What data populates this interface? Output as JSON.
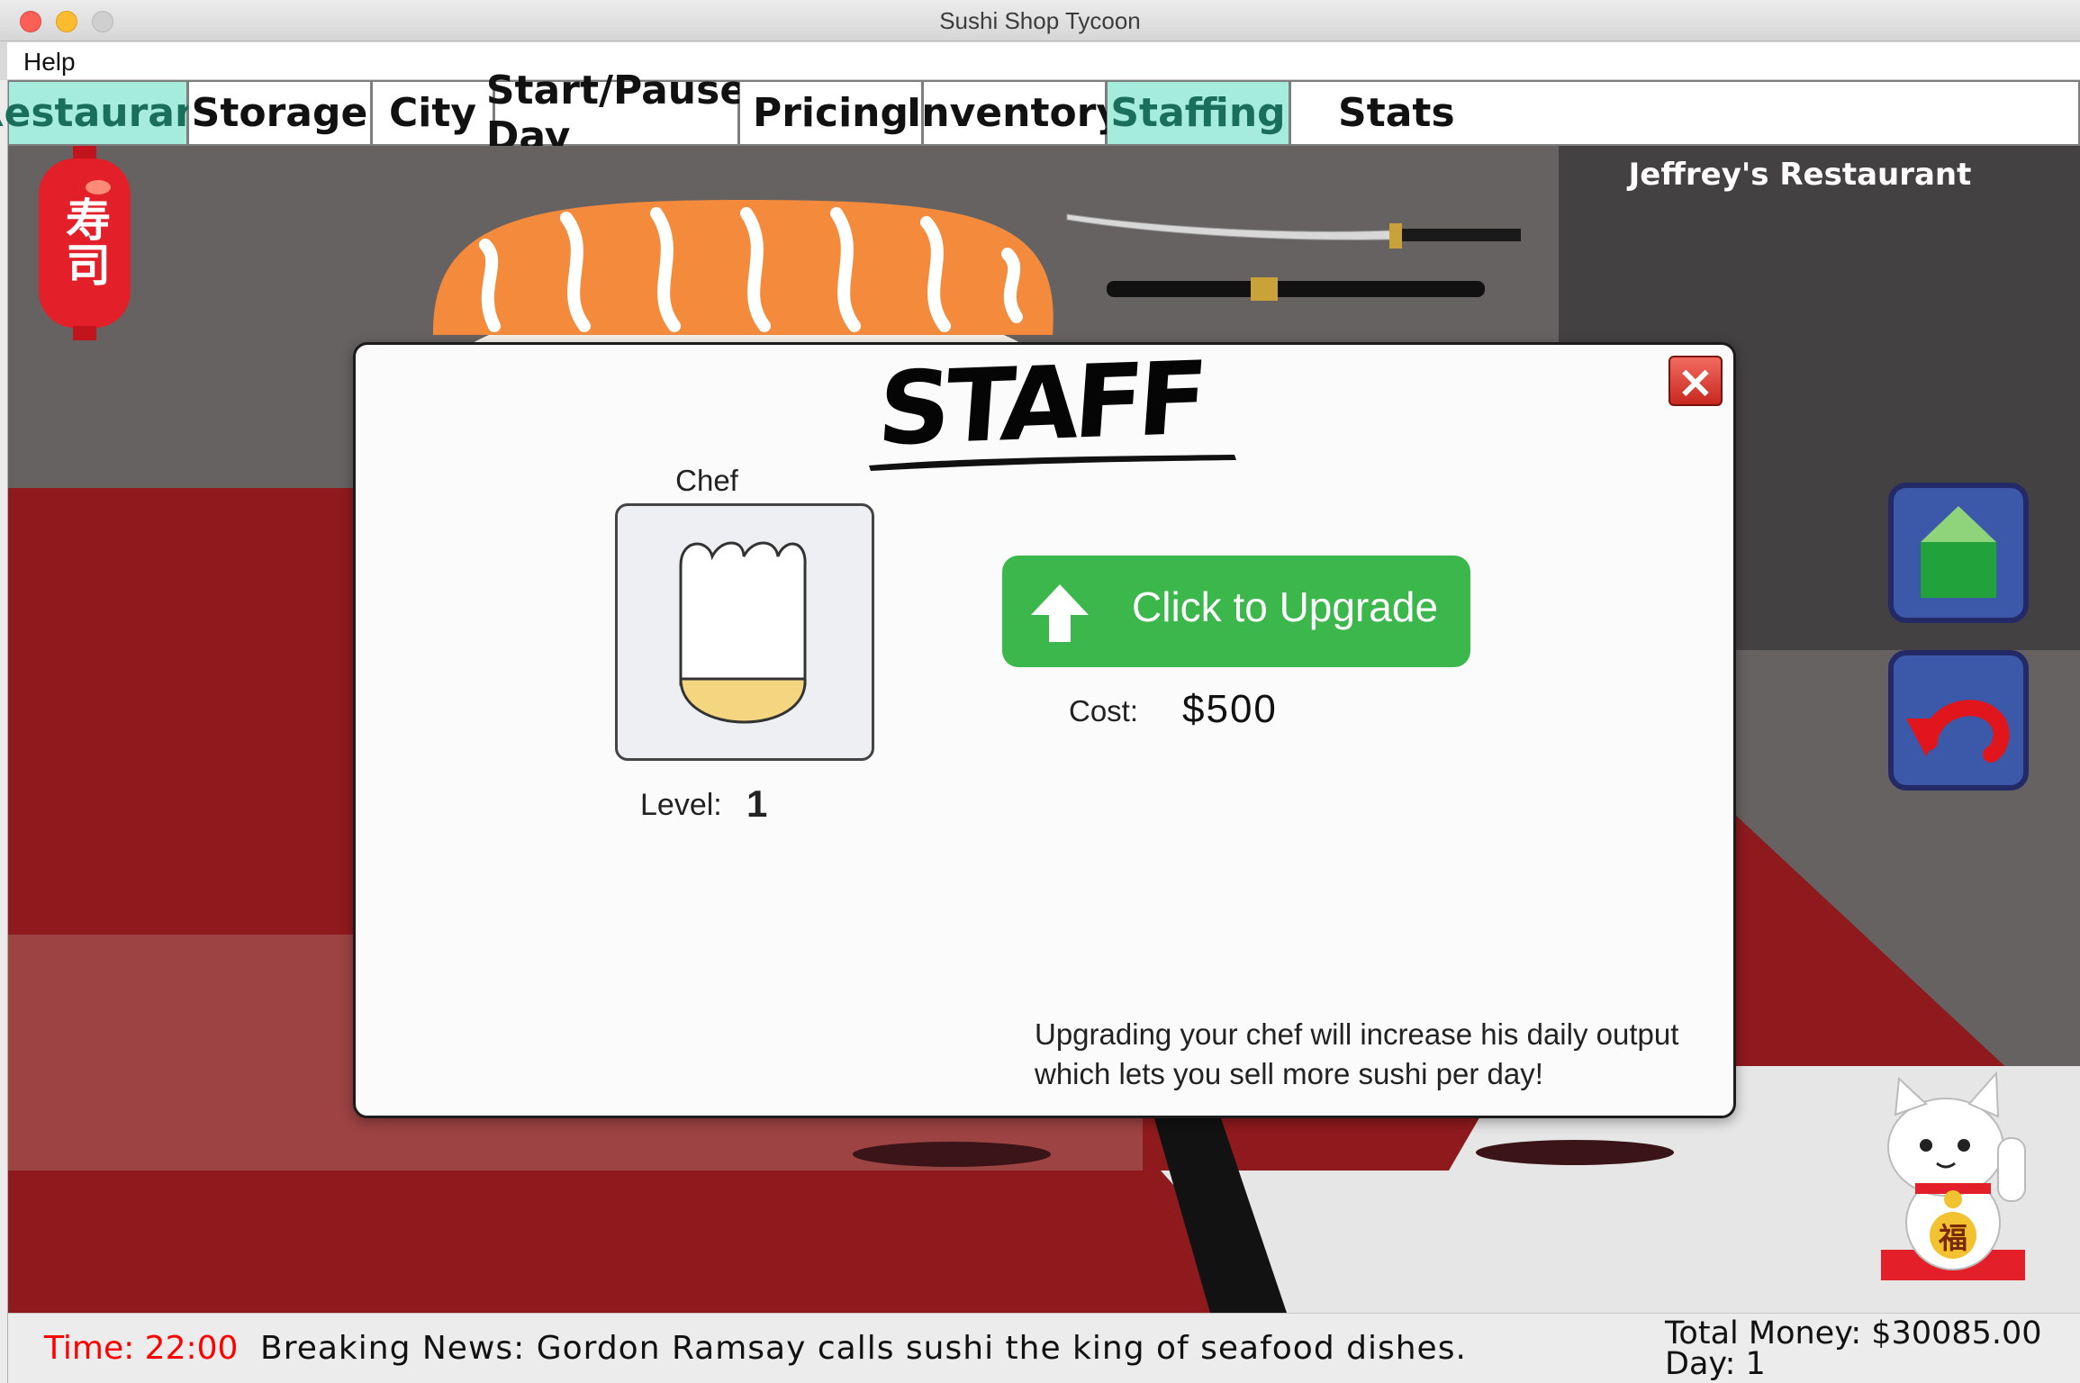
{
  "window": {
    "title": "Sushi Shop Tycoon"
  },
  "menu": {
    "help": "Help"
  },
  "tabs": [
    {
      "label": "Restaurant",
      "active": true
    },
    {
      "label": "Storage",
      "active": false
    },
    {
      "label": "City",
      "active": false
    },
    {
      "label": "Start/Pause Day",
      "active": false
    },
    {
      "label": "Pricing",
      "active": false
    },
    {
      "label": "Inventory",
      "active": false
    },
    {
      "label": "Staffing",
      "active": true
    },
    {
      "label": "Stats",
      "active": false
    }
  ],
  "scene": {
    "restaurant_name": "Jeffrey's Restaurant",
    "lantern_text": "寿司",
    "cat_charm_text": "福",
    "up_button_icon": "green-house-up-icon",
    "back_button_icon": "red-undo-arrow-icon"
  },
  "modal": {
    "title": "STAFF",
    "close_icon": "close-x-icon",
    "staff": {
      "role": "Chef",
      "icon": "chef-hat-icon",
      "level_label": "Level:",
      "level": "1"
    },
    "upgrade": {
      "label": "Click to Upgrade",
      "icon": "up-arrow-icon",
      "cost_label": "Cost:",
      "cost": "$500"
    },
    "hint_line1": "Upgrading your chef will increase his daily output",
    "hint_line2": "which lets you sell more sushi per day!"
  },
  "status": {
    "time": "Time: 22:00",
    "news": "Breaking News:  Gordon Ramsay calls sushi the king of seafood dishes.",
    "total_money": "Total Money: $30085.00",
    "day": "Day:   1"
  },
  "colors": {
    "active_tab": "#a6ecdc",
    "upgrade_green": "#3cb74b",
    "floor_red": "#8e1a1e",
    "time_red": "#ff0000"
  }
}
